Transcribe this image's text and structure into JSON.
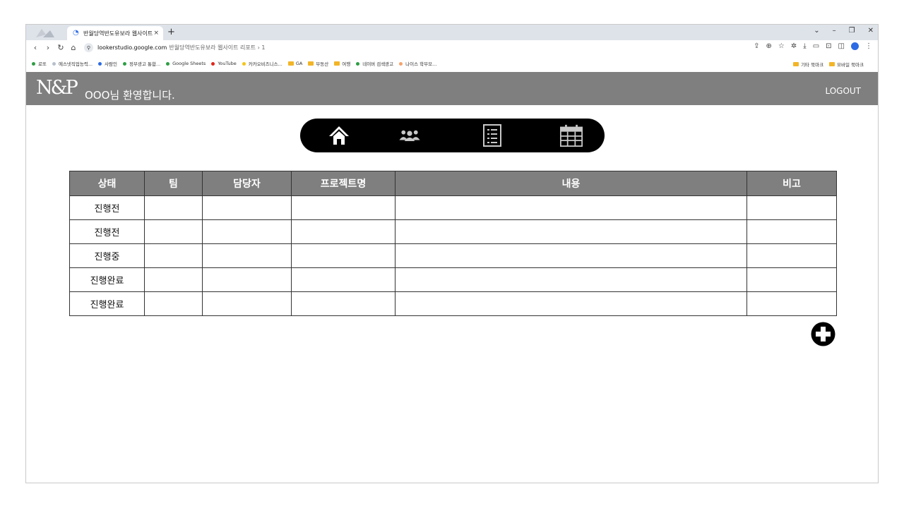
{
  "browser": {
    "tab_title": "반월당역반도유보라 웹사이트",
    "tab_close": "×",
    "new_tab": "+",
    "window_controls": [
      "⌄",
      "–",
      "❐",
      "✕"
    ],
    "url_host": "lookerstudio.google.com",
    "url_path": "반월당역반도유보라 웹사이트 리포트 › 1",
    "bookmarks": [
      {
        "label": "로또",
        "color": "#2e9e44",
        "kind": "dot"
      },
      {
        "label": "에스넷직업능력...",
        "color": "#b7c0cc",
        "kind": "dot"
      },
      {
        "label": "사람인",
        "color": "#2d6be4",
        "kind": "dot"
      },
      {
        "label": "정부광고 통합...",
        "color": "#2e9e44",
        "kind": "dot"
      },
      {
        "label": "Google Sheets",
        "color": "#2e9e44",
        "kind": "dot"
      },
      {
        "label": "YouTube",
        "color": "#e2261b",
        "kind": "dot"
      },
      {
        "label": "카카오비즈니스...",
        "color": "#f5c518",
        "kind": "dot"
      },
      {
        "label": "GA",
        "color": "#f2b528",
        "kind": "folder"
      },
      {
        "label": "부동산",
        "color": "#f2b528",
        "kind": "folder"
      },
      {
        "label": "여행",
        "color": "#f2b528",
        "kind": "folder"
      },
      {
        "label": "네이버 검색광고",
        "color": "#2e9e44",
        "kind": "dot"
      },
      {
        "label": "나이스 학부모...",
        "color": "#f5a36b",
        "kind": "dot"
      }
    ],
    "bookmarks_right": [
      "기타 북마크",
      "모바일 북마크"
    ]
  },
  "app": {
    "logo": "N&P",
    "welcome": "OOO님 환영합니다.",
    "logout": "LOGOUT",
    "nav_icons": [
      "home-icon",
      "team-icon",
      "list-icon",
      "calendar-icon"
    ]
  },
  "table": {
    "headers": [
      "상태",
      "팀",
      "담당자",
      "프로젝트명",
      "내용",
      "비고"
    ],
    "rows": [
      [
        "진행전",
        "",
        "",
        "",
        "",
        ""
      ],
      [
        "진행전",
        "",
        "",
        "",
        "",
        ""
      ],
      [
        "진행중",
        "",
        "",
        "",
        "",
        ""
      ],
      [
        "진행완료",
        "",
        "",
        "",
        "",
        ""
      ],
      [
        "진행완료",
        "",
        "",
        "",
        "",
        ""
      ]
    ]
  },
  "colors": {
    "header_gray": "#7f7f7f",
    "nav_bg": "#000000",
    "icon_white": "#ffffff",
    "icon_gray": "#c8c8c8"
  }
}
